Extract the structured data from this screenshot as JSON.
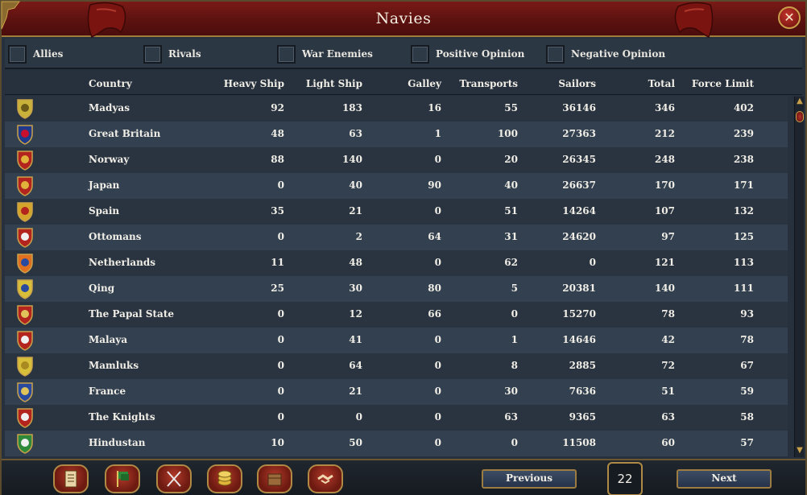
{
  "window": {
    "title": "Navies",
    "close_glyph": "✕"
  },
  "filters": [
    {
      "label": "Allies",
      "checked": false
    },
    {
      "label": "Rivals",
      "checked": false
    },
    {
      "label": "War Enemies",
      "checked": false
    },
    {
      "label": "Positive Opinion",
      "checked": false
    },
    {
      "label": "Negative Opinion",
      "checked": false
    }
  ],
  "table": {
    "headers": [
      "Country",
      "Heavy Ship",
      "Light Ship",
      "Galley",
      "Transports",
      "Sailors",
      "Total",
      "Force Limit"
    ],
    "rows": [
      {
        "country": "Madyas",
        "heavy": "92",
        "light": "183",
        "galley": "16",
        "transports": "55",
        "sailors": "36146",
        "total": "346",
        "force_limit": "402",
        "flag": {
          "bg": "#c9b23a",
          "fg": "#6b5a18",
          "icon": "lion-shield"
        }
      },
      {
        "country": "Great Britain",
        "heavy": "48",
        "light": "63",
        "galley": "1",
        "transports": "100",
        "sailors": "27363",
        "total": "212",
        "force_limit": "239",
        "flag": {
          "bg": "#1f3a8a",
          "fg": "#c8102e",
          "icon": "union-jack"
        }
      },
      {
        "country": "Norway",
        "heavy": "88",
        "light": "140",
        "galley": "0",
        "transports": "20",
        "sailors": "26345",
        "total": "248",
        "force_limit": "238",
        "flag": {
          "bg": "#b2241d",
          "fg": "#e0b43a",
          "icon": "lion-shield"
        }
      },
      {
        "country": "Japan",
        "heavy": "0",
        "light": "40",
        "galley": "90",
        "transports": "40",
        "sailors": "26637",
        "total": "170",
        "force_limit": "171",
        "flag": {
          "bg": "#b2241d",
          "fg": "#e0b43a",
          "icon": "chrysanthemum"
        }
      },
      {
        "country": "Spain",
        "heavy": "35",
        "light": "21",
        "galley": "0",
        "transports": "51",
        "sailors": "14264",
        "total": "107",
        "force_limit": "132",
        "flag": {
          "bg": "#d4a52a",
          "fg": "#b2241d",
          "icon": "quartered-shield"
        }
      },
      {
        "country": "Ottomans",
        "heavy": "0",
        "light": "2",
        "galley": "64",
        "transports": "31",
        "sailors": "24620",
        "total": "97",
        "force_limit": "125",
        "flag": {
          "bg": "#b2241d",
          "fg": "#f0f0f0",
          "icon": "crescent"
        }
      },
      {
        "country": "Netherlands",
        "heavy": "11",
        "light": "48",
        "galley": "0",
        "transports": "62",
        "sailors": "0",
        "total": "121",
        "force_limit": "113",
        "flag": {
          "bg": "#e06f1f",
          "fg": "#2a4aa0",
          "icon": "tricolour"
        }
      },
      {
        "country": "Qing",
        "heavy": "25",
        "light": "30",
        "galley": "80",
        "transports": "5",
        "sailors": "20381",
        "total": "140",
        "force_limit": "111",
        "flag": {
          "bg": "#d8bf3a",
          "fg": "#2a4aa0",
          "icon": "dragon"
        }
      },
      {
        "country": "The Papal State",
        "heavy": "0",
        "light": "12",
        "galley": "66",
        "transports": "0",
        "sailors": "15270",
        "total": "78",
        "force_limit": "93",
        "flag": {
          "bg": "#b2241d",
          "fg": "#e0c35a",
          "icon": "keys"
        }
      },
      {
        "country": "Malaya",
        "heavy": "0",
        "light": "41",
        "galley": "0",
        "transports": "1",
        "sailors": "14646",
        "total": "42",
        "force_limit": "78",
        "flag": {
          "bg": "#b2241d",
          "fg": "#f0f0f0",
          "icon": "split-shield"
        }
      },
      {
        "country": "Mamluks",
        "heavy": "0",
        "light": "64",
        "galley": "0",
        "transports": "8",
        "sailors": "2885",
        "total": "72",
        "force_limit": "67",
        "flag": {
          "bg": "#d8bf3a",
          "fg": "#a88a20",
          "icon": "plain-shield"
        }
      },
      {
        "country": "France",
        "heavy": "0",
        "light": "21",
        "galley": "0",
        "transports": "30",
        "sailors": "7636",
        "total": "51",
        "force_limit": "59",
        "flag": {
          "bg": "#2a4aa0",
          "fg": "#e0c35a",
          "icon": "fleur-de-lis"
        }
      },
      {
        "country": "The Knights",
        "heavy": "0",
        "light": "0",
        "galley": "0",
        "transports": "63",
        "sailors": "9365",
        "total": "63",
        "force_limit": "58",
        "flag": {
          "bg": "#b2241d",
          "fg": "#f0f0f0",
          "icon": "maltese-cross"
        }
      },
      {
        "country": "Hindustan",
        "heavy": "10",
        "light": "50",
        "galley": "0",
        "transports": "0",
        "sailors": "11508",
        "total": "60",
        "force_limit": "57",
        "flag": {
          "bg": "#2e8a3a",
          "fg": "#f0f0f0",
          "icon": "crescent"
        }
      }
    ]
  },
  "bottom": {
    "buttons": [
      "ledger-icon",
      "flags-icon",
      "crossed-swords-icon",
      "coins-icon",
      "trade-goods-icon",
      "handshake-icon"
    ],
    "previous_label": "Previous",
    "next_label": "Next",
    "page": "22"
  }
}
